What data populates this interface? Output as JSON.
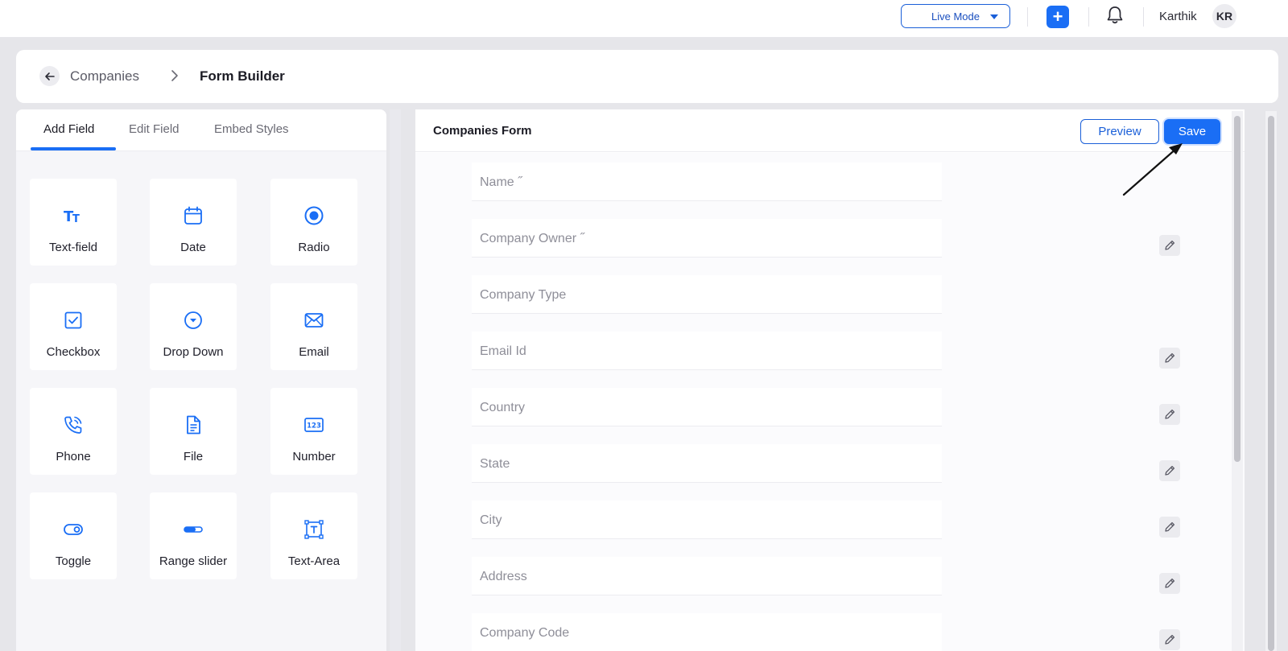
{
  "topbar": {
    "mode_label": "Live Mode",
    "add_symbol": "+",
    "user_name": "Karthik",
    "user_initials": "KR"
  },
  "breadcrumb": {
    "parent": "Companies",
    "current": "Form Builder"
  },
  "left_panel": {
    "tabs": [
      "Add Field",
      "Edit Field",
      "Embed Styles"
    ],
    "active_tab": "Add Field",
    "fields": [
      {
        "label": "Text-field",
        "icon": "text-format-icon"
      },
      {
        "label": "Date",
        "icon": "calendar-icon"
      },
      {
        "label": "Radio",
        "icon": "radio-icon"
      },
      {
        "label": "Checkbox",
        "icon": "checkbox-icon"
      },
      {
        "label": "Drop Down",
        "icon": "dropdown-icon"
      },
      {
        "label": "Email",
        "icon": "envelope-icon"
      },
      {
        "label": "Phone",
        "icon": "phone-icon"
      },
      {
        "label": "File",
        "icon": "file-icon"
      },
      {
        "label": "Number",
        "icon": "number-123-icon"
      },
      {
        "label": "Toggle",
        "icon": "toggle-icon"
      },
      {
        "label": "Range slider",
        "icon": "range-slider-icon"
      },
      {
        "label": "Text-Area",
        "icon": "text-area-icon"
      }
    ]
  },
  "form": {
    "title": "Companies Form",
    "preview_label": "Preview",
    "save_label": "Save",
    "fields": [
      {
        "placeholder": "Name ˝",
        "editable": false
      },
      {
        "placeholder": "Company Owner ˝",
        "editable": true
      },
      {
        "placeholder": "Company Type",
        "editable": false
      },
      {
        "placeholder": "Email Id",
        "editable": true
      },
      {
        "placeholder": "Country",
        "editable": true
      },
      {
        "placeholder": "State",
        "editable": true
      },
      {
        "placeholder": "City",
        "editable": true
      },
      {
        "placeholder": "Address",
        "editable": true
      },
      {
        "placeholder": "Company Code",
        "editable": true
      }
    ]
  },
  "colors": {
    "accent": "#1a6ef5",
    "background": "#e6e6ea"
  }
}
